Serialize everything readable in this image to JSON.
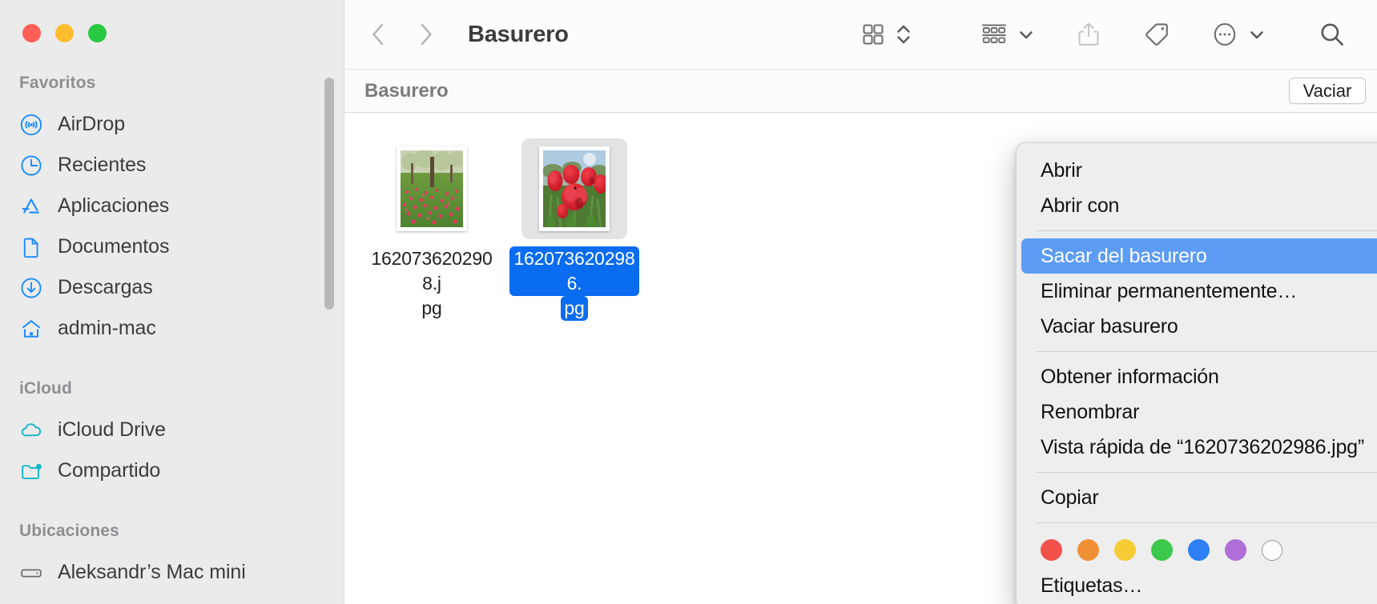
{
  "window": {
    "traffic_lights": [
      {
        "name": "close",
        "color": "#ff5f57"
      },
      {
        "name": "minimize",
        "color": "#febc2e"
      },
      {
        "name": "maximize",
        "color": "#28c840"
      }
    ]
  },
  "sidebar": {
    "groups": [
      {
        "title": "Favoritos",
        "items": [
          {
            "label": "AirDrop",
            "icon": "airdrop-icon"
          },
          {
            "label": "Recientes",
            "icon": "clock-icon"
          },
          {
            "label": "Aplicaciones",
            "icon": "applications-icon"
          },
          {
            "label": "Documentos",
            "icon": "document-icon"
          },
          {
            "label": "Descargas",
            "icon": "download-icon"
          },
          {
            "label": "admin-mac",
            "icon": "home-icon"
          }
        ]
      },
      {
        "title": "iCloud",
        "items": [
          {
            "label": "iCloud Drive",
            "icon": "cloud-icon"
          },
          {
            "label": "Compartido",
            "icon": "shared-folder-icon"
          }
        ]
      },
      {
        "title": "Ubicaciones",
        "items": [
          {
            "label": "Aleksandr’s Mac mini",
            "icon": "mac-mini-icon"
          }
        ]
      }
    ]
  },
  "toolbar": {
    "back_icon": "chevron-left-icon",
    "forward_icon": "chevron-right-icon",
    "title": "Basurero",
    "view_icon": "icon-view-icon",
    "view_stepper_icon": "chevron-up-down-icon",
    "group_icon": "group-by-icon",
    "group_chevron_icon": "chevron-down-icon",
    "share_icon": "share-icon",
    "tag_icon": "tag-icon",
    "more_icon": "more-ellipsis-icon",
    "more_chevron_icon": "chevron-down-icon",
    "search_icon": "search-icon"
  },
  "pathbar": {
    "label": "Basurero",
    "empty_button": "Vaciar"
  },
  "files": [
    {
      "name_lines": [
        "1620736202908.j",
        "pg"
      ],
      "full_name": "1620736202908.jpg",
      "selected": false,
      "thumbnail": "tulip-field-with-trees"
    },
    {
      "name_lines": [
        "1620736202986.",
        "pg"
      ],
      "full_name": "1620736202986.jpg",
      "selected": true,
      "thumbnail": "red-tulips-closeup"
    }
  ],
  "context_menu": {
    "items": [
      {
        "label": "Abrir",
        "type": "item"
      },
      {
        "label": "Abrir con",
        "type": "submenu"
      },
      {
        "type": "separator"
      },
      {
        "label": "Sacar del basurero",
        "type": "item",
        "highlighted": true
      },
      {
        "label": "Eliminar permanentemente…",
        "type": "item"
      },
      {
        "label": "Vaciar basurero",
        "type": "item"
      },
      {
        "type": "separator"
      },
      {
        "label": "Obtener información",
        "type": "item"
      },
      {
        "label": "Renombrar",
        "type": "item"
      },
      {
        "label": "Vista rápida de “1620736202986.jpg”",
        "type": "item"
      },
      {
        "type": "separator"
      },
      {
        "label": "Copiar",
        "type": "item"
      },
      {
        "type": "separator"
      },
      {
        "type": "tags"
      },
      {
        "label": "Etiquetas…",
        "type": "item"
      }
    ],
    "tag_colors": [
      {
        "name": "red",
        "color": "#f1534b"
      },
      {
        "name": "orange",
        "color": "#ef9037"
      },
      {
        "name": "yellow",
        "color": "#f6cc36"
      },
      {
        "name": "green",
        "color": "#3cc84a"
      },
      {
        "name": "blue",
        "color": "#2f80f5"
      },
      {
        "name": "purple",
        "color": "#b06ed8"
      },
      {
        "name": "none",
        "color": "#ffffff"
      }
    ],
    "highlight_color": "#5c9cf5"
  }
}
